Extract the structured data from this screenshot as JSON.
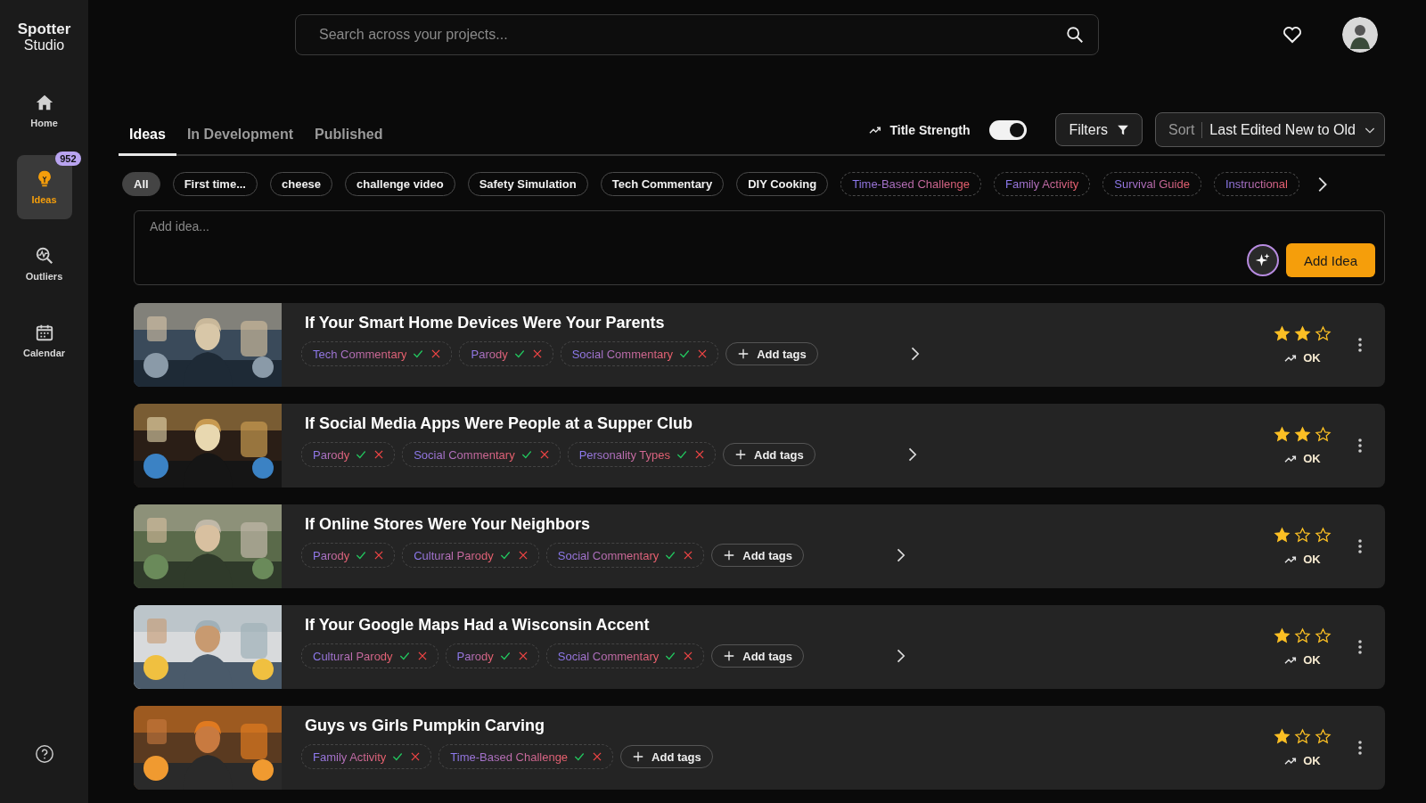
{
  "brand": {
    "line1": "Spotter",
    "line2": "Studio"
  },
  "nav": [
    {
      "label": "Home",
      "selected": false
    },
    {
      "label": "Ideas",
      "selected": true,
      "badge": "952"
    },
    {
      "label": "Outliers",
      "selected": false
    },
    {
      "label": "Calendar",
      "selected": false
    }
  ],
  "search": {
    "placeholder": "Search across your projects..."
  },
  "tabs": [
    {
      "label": "Ideas",
      "selected": true
    },
    {
      "label": "In Development",
      "selected": false
    },
    {
      "label": "Published",
      "selected": false
    }
  ],
  "title_strength": {
    "label": "Title Strength",
    "on": true
  },
  "filters_button": "Filters",
  "sort": {
    "label": "Sort",
    "value": "Last Edited New to Old"
  },
  "chips": [
    {
      "label": "All",
      "kind": "keyword",
      "selected": true
    },
    {
      "label": "First time...",
      "kind": "keyword",
      "selected": false
    },
    {
      "label": "cheese",
      "kind": "keyword",
      "selected": false
    },
    {
      "label": "challenge video",
      "kind": "keyword",
      "selected": false
    },
    {
      "label": "Safety Simulation",
      "kind": "keyword",
      "selected": false
    },
    {
      "label": "Tech Commentary",
      "kind": "keyword",
      "selected": false
    },
    {
      "label": "DIY Cooking",
      "kind": "keyword",
      "selected": false
    },
    {
      "label": "Time-Based Challenge",
      "kind": "suggested",
      "selected": false
    },
    {
      "label": "Family Activity",
      "kind": "suggested",
      "selected": false
    },
    {
      "label": "Survival Guide",
      "kind": "suggested",
      "selected": false
    },
    {
      "label": "Instructional",
      "kind": "suggested",
      "selected": false
    }
  ],
  "idea_input": {
    "placeholder": "Add idea...",
    "button": "Add Idea"
  },
  "ideas": [
    {
      "title": "If Your Smart Home Devices Were Your Parents",
      "tags": [
        "Tech Commentary",
        "Parody",
        "Social Commentary"
      ],
      "add_tags": "Add tags",
      "stars": 2,
      "strength": "OK",
      "expandable": true
    },
    {
      "title": "If Social Media Apps Were People at a Supper Club",
      "tags": [
        "Parody",
        "Social Commentary",
        "Personality Types"
      ],
      "add_tags": "Add tags",
      "stars": 2,
      "strength": "OK",
      "expandable": true
    },
    {
      "title": "If Online Stores Were Your Neighbors",
      "tags": [
        "Parody",
        "Cultural Parody",
        "Social Commentary"
      ],
      "add_tags": "Add tags",
      "stars": 1,
      "strength": "OK",
      "expandable": true
    },
    {
      "title": "If Your Google Maps Had a Wisconsin Accent",
      "tags": [
        "Cultural Parody",
        "Parody",
        "Social Commentary"
      ],
      "add_tags": "Add tags",
      "stars": 1,
      "strength": "OK",
      "expandable": true
    },
    {
      "title": "Guys vs Girls Pumpkin Carving",
      "tags": [
        "Family Activity",
        "Time-Based Challenge"
      ],
      "add_tags": "Add tags",
      "stars": 1,
      "strength": "OK",
      "expandable": false
    }
  ]
}
